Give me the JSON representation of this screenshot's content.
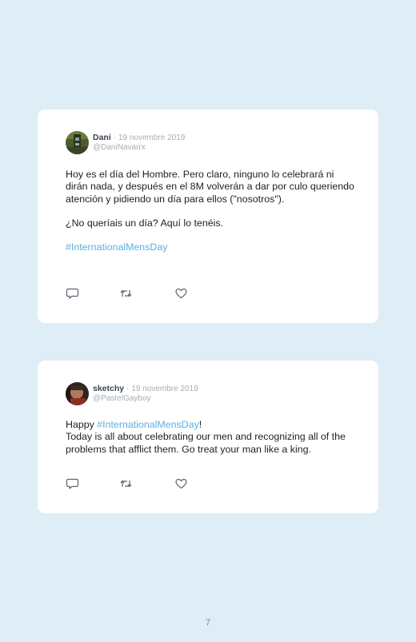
{
  "tweets": [
    {
      "name": "Dani",
      "separator": "·",
      "date": "19 novembre 2019",
      "handle": "@DaniNavarrx",
      "avatar_icon": "avatar-photo",
      "paragraphs": [
        "Hoy es el día del Hombre. Pero claro, ninguno lo celebrará ni dirán nada, y después en el 8M volverán a dar por culo queriendo atención y pidiendo un día para ellos (\"nosotros\").",
        "¿No queríais un día? Aquí lo tenéis."
      ],
      "hashtag": "#InternationalMensDay"
    },
    {
      "name": "sketchy",
      "separator": "·",
      "date": "19 novembre 2019",
      "handle": "@PastelGayboy",
      "avatar_icon": "avatar-photo",
      "text_before": "Happy ",
      "hashtag": "#InternationalMensDay",
      "text_after": "!",
      "paragraph2": "Today is all about celebrating our men and recognizing all of the problems that afflict them. Go treat your man like a king."
    }
  ],
  "actions": {
    "icons": [
      "reply-icon",
      "retweet-icon",
      "like-icon"
    ]
  },
  "colors": {
    "background": "#dfedf6",
    "card": "#ffffff",
    "hashtag": "#58b1e0",
    "muted": "#a7adb4"
  },
  "page_number": "7"
}
